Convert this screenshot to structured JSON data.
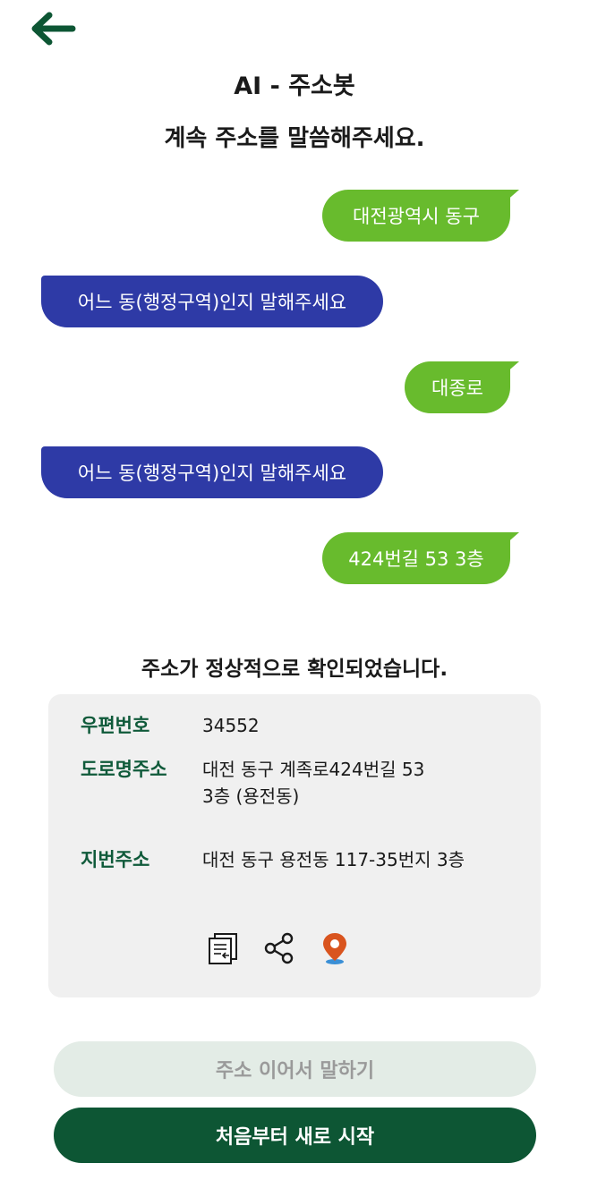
{
  "header": {
    "title": "AI - 주소봇",
    "subtitle": "계속 주소를 말씀해주세요."
  },
  "chat": {
    "messages": [
      {
        "sender": "user",
        "text": "대전광역시 동구"
      },
      {
        "sender": "bot",
        "text": "어느 동(행정구역)인지 말해주세요"
      },
      {
        "sender": "user",
        "text": "대종로"
      },
      {
        "sender": "bot",
        "text": "어느 동(행정구역)인지 말해주세요"
      },
      {
        "sender": "user",
        "text": "424번길 53 3층"
      }
    ]
  },
  "result": {
    "confirm_text": "주소가 정상적으로 확인되었습니다.",
    "postal_label": "우편번호",
    "postal_value": "34552",
    "road_label": "도로명주소",
    "road_value_line1": "대전 동구 계족로424번길 53",
    "road_value_line2": "3층 (용전동)",
    "lot_label": "지번주소",
    "lot_value": "대전 동구 용전동 117-35번지 3층"
  },
  "actions": {
    "continue_label": "주소 이어서 말하기",
    "restart_label": "처음부터 새로 시작"
  },
  "colors": {
    "user_bubble": "#68bb2d",
    "bot_bubble": "#2e3aa6",
    "brand_green": "#0d5634",
    "label_green": "#0f5a3a",
    "pin_orange": "#d9541e"
  },
  "icons": {
    "back": "arrow-left-icon",
    "copy": "copy-icon",
    "share": "share-icon",
    "map": "map-pin-icon"
  }
}
